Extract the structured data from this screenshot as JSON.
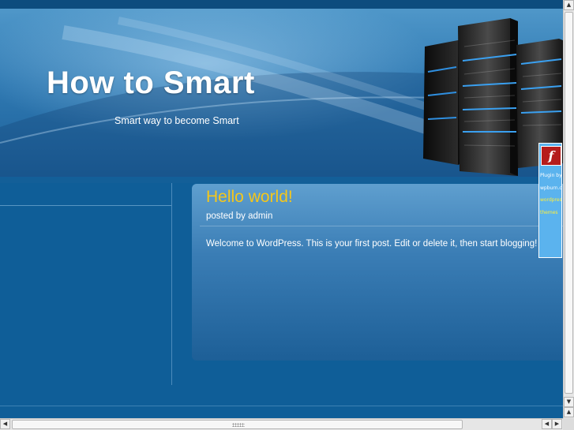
{
  "site": {
    "title": "How to Smart",
    "tagline": "Smart way to become Smart"
  },
  "post": {
    "title": "Hello world!",
    "meta": "posted by admin",
    "content": "Welcome to WordPress. This is your first post. Edit or delete it, then start blogging!"
  },
  "flash_widget": {
    "icon_letter": "f",
    "line1": "Plugin by",
    "line2": "wpburn.com",
    "line3": "wordpress",
    "line4": "themes"
  },
  "colors": {
    "page_background": "#0f5e98",
    "post_title": "#f6c719",
    "widget_background": "#5bb3ee",
    "flash_red": "#b51c1c"
  },
  "icons": [
    "server-rack-image",
    "adobe-flash-icon",
    "scroll-arrow-up-icon",
    "scroll-arrow-down-icon",
    "scroll-arrow-left-icon",
    "scroll-arrow-right-icon"
  ]
}
